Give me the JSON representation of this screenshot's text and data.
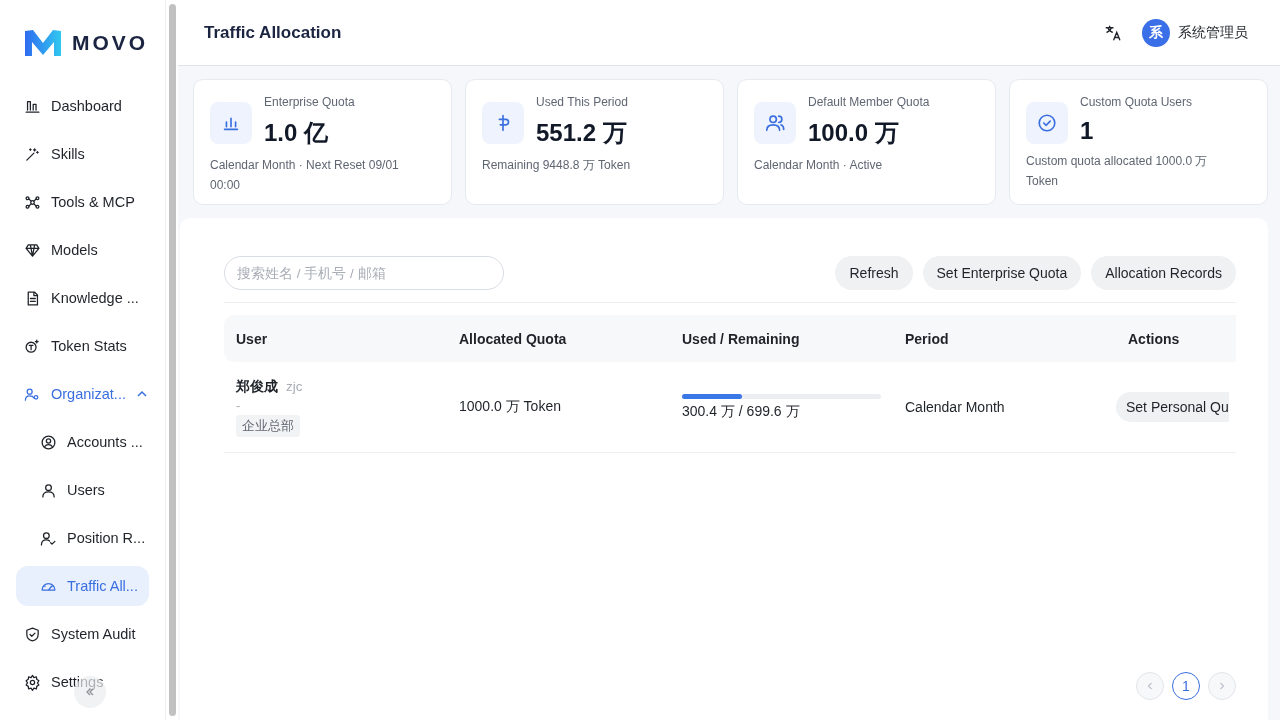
{
  "brand": {
    "name": "MOVO"
  },
  "sidebar": {
    "items": [
      {
        "label": "Dashboard",
        "selected": false
      },
      {
        "label": "Skills",
        "selected": false
      },
      {
        "label": "Tools & MCP",
        "selected": false
      },
      {
        "label": "Models",
        "selected": false
      },
      {
        "label": "Knowledge ...",
        "selected": false
      },
      {
        "label": "Token Stats",
        "selected": false
      },
      {
        "label": "Organizat...",
        "selected": false,
        "expanded": true,
        "children": [
          {
            "label": "Accounts ...",
            "selected": false
          },
          {
            "label": "Users",
            "selected": false
          },
          {
            "label": "Position R...",
            "selected": false
          },
          {
            "label": "Traffic All...",
            "selected": true
          }
        ]
      },
      {
        "label": "System Audit",
        "selected": false
      },
      {
        "label": "Settings",
        "selected": false
      }
    ]
  },
  "header": {
    "title": "Traffic Allocation",
    "user": {
      "avatar": "系",
      "name": "系统管理员"
    }
  },
  "stats": [
    {
      "label": "Enterprise Quota",
      "value": "1.0 亿",
      "note": "Calendar Month · Next Reset 09/01 00:00"
    },
    {
      "label": "Used This Period",
      "value": "551.2 万",
      "note": "Remaining 9448.8 万 Token"
    },
    {
      "label": "Default Member Quota",
      "value": "100.0 万",
      "note": "Calendar Month · Active"
    },
    {
      "label": "Custom Quota Users",
      "value": "1",
      "note": "Custom quota allocated 1000.0 万 Token"
    }
  ],
  "toolbar": {
    "search": {
      "placeholder": "搜索姓名 / 手机号 / 邮箱"
    },
    "buttons": [
      "Refresh",
      "Set Enterprise Quota",
      "Allocation Records"
    ]
  },
  "table": {
    "columns": [
      "User",
      "Allocated Quota",
      "Used / Remaining",
      "Period",
      "Actions"
    ],
    "rows": [
      {
        "name": "郑俊成",
        "username": "zjc",
        "contact": "-",
        "department": "企业总部",
        "allocated": "1000.0 万 Token",
        "usage": {
          "level": 0.3,
          "reading": "300.4 万 / 699.6 万"
        },
        "period": "Calendar Month",
        "action": "Set Personal Qu"
      }
    ]
  },
  "pagination": {
    "prev_disabled": true,
    "next_disabled": true,
    "pages": [
      {
        "label": "1",
        "selected": true
      }
    ]
  }
}
